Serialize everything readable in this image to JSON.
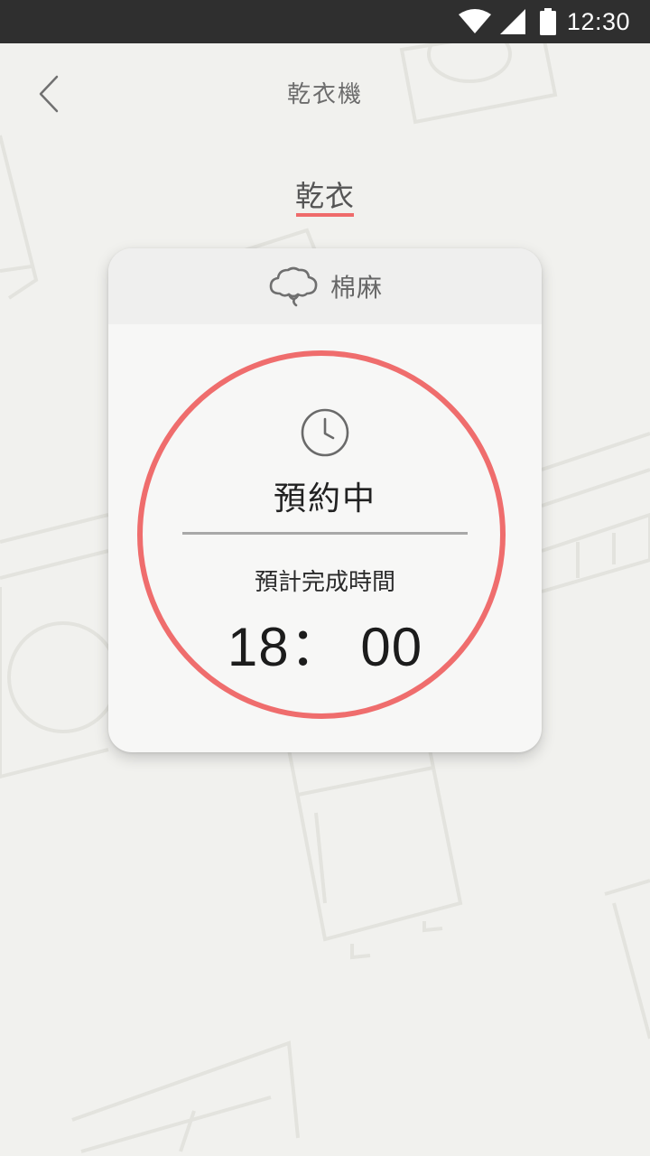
{
  "status_bar": {
    "time": "12:30",
    "icons": [
      "wifi-icon",
      "signal-icon",
      "battery-icon"
    ]
  },
  "header": {
    "title": "乾衣機",
    "back_icon": "back-chevron-icon"
  },
  "tabs": [
    {
      "label": "乾衣",
      "active": true
    }
  ],
  "card": {
    "mode_icon": "cotton-icon",
    "mode_label": "棉麻",
    "status_icon": "clock-icon",
    "status": "預約中",
    "finish_label": "預計完成時間",
    "finish_time": "18： 00"
  },
  "colors": {
    "accent": "#ef6d6d",
    "background": "#f1f1ee",
    "status_bar": "#2f2f2f"
  }
}
